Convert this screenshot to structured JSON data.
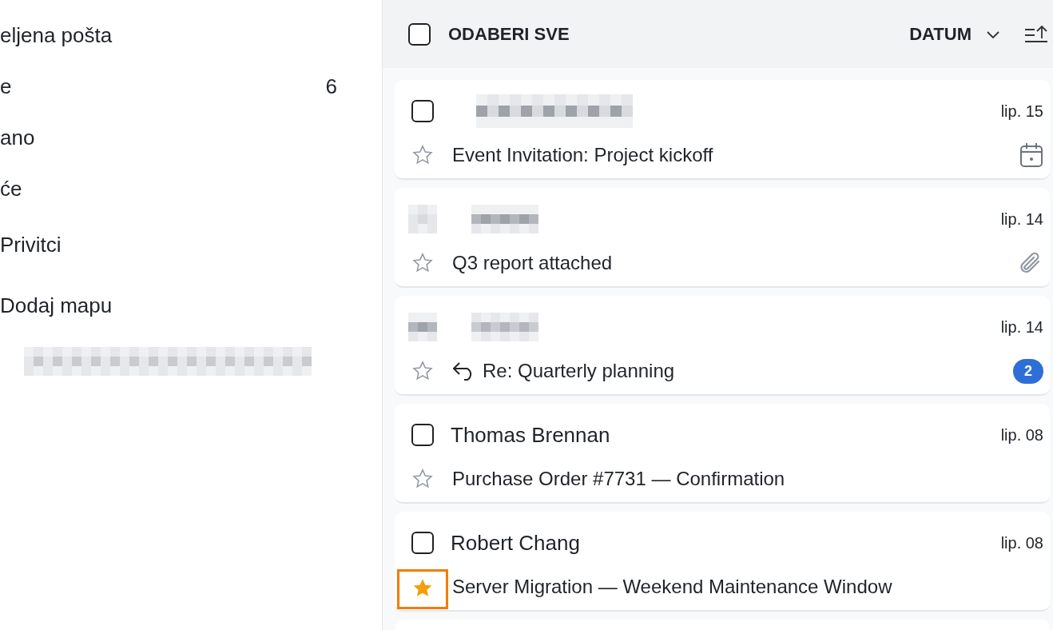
{
  "sidebar": {
    "items": [
      {
        "kind": "folder",
        "label": "eljena pošta"
      },
      {
        "kind": "folder",
        "label": "e",
        "count": "6"
      },
      {
        "kind": "folder",
        "label": "ano"
      },
      {
        "kind": "folder",
        "label": "će"
      },
      {
        "kind": "folder",
        "label": "Privitci"
      },
      {
        "kind": "folder",
        "label": "Dodaj mapu"
      },
      {
        "kind": "redacted"
      }
    ]
  },
  "toolbar": {
    "select_all": {
      "label": "ODABERI SVE",
      "checked": false
    },
    "sort": {
      "label": "DATUM"
    }
  },
  "messages": [
    {
      "checked": false,
      "sender_redacted": true,
      "date": "lip. 15",
      "subject": "Event Invitation: Project kickoff",
      "starred": false,
      "focused": false,
      "invitation": true
    },
    {
      "avatar_redacted": true,
      "sender_redacted": true,
      "date": "lip. 14",
      "subject": "Q3 report attached",
      "starred": false,
      "focused": false,
      "attachment": true
    },
    {
      "avatar_redacted": true,
      "sender_redacted": true,
      "date": "lip. 14",
      "subject": "Re: Quarterly planning",
      "replied": true,
      "starred": false,
      "focused": false,
      "count": "2"
    },
    {
      "checked": false,
      "sender": "Thomas Brennan",
      "date": "lip. 08",
      "subject": "Purchase Order #7731 — Confirmation",
      "starred": false,
      "focused": false
    },
    {
      "checked": false,
      "sender": "Robert Chang",
      "date": "lip. 08",
      "subject": "Server Migration — Weekend Maintenance Window",
      "starred": true,
      "focused": true
    }
  ]
}
